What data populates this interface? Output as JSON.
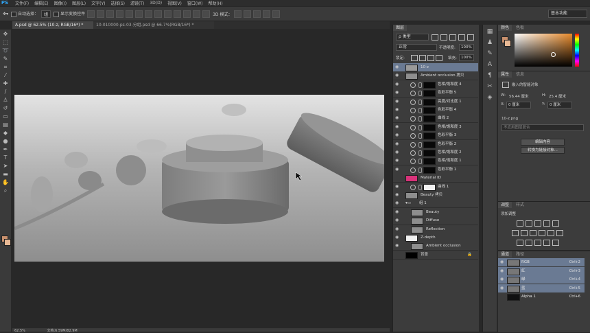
{
  "menubar": {
    "logo": "PS",
    "items": [
      "文件(F)",
      "编辑(E)",
      "图像(I)",
      "图层(L)",
      "文字(Y)",
      "选择(S)",
      "滤镜(T)",
      "3D(D)",
      "视图(V)",
      "窗口(W)",
      "帮助(H)"
    ]
  },
  "options": {
    "auto_select_label": "自动选择：",
    "auto_select_value": "组",
    "show_transform_label": "显示变换控件",
    "mode3d_label": "3D 模式：",
    "workspace": "基本功能"
  },
  "tabs": [
    {
      "label": "A.psd @ 62.5% (10-z, RGB/16*) *"
    },
    {
      "label": "10-010000-ps-03-分组.psd @ 66.7%(RGB/16*) *"
    }
  ],
  "status": {
    "zoom": "62.5%",
    "doc": "文档:6.59M/82.9M"
  },
  "layers_panel": {
    "tabs": [
      "图层"
    ],
    "kind_filter": "ρ 类型",
    "blend_mode": "正常",
    "opacity_label": "不透明度:",
    "opacity_value": "100%",
    "lock_label": "锁定:",
    "fill_label": "填充:",
    "fill_value": "100%",
    "layers": [
      {
        "name": "10-z",
        "type": "smart",
        "selected": true
      },
      {
        "name": "Ambient occlusion 拷贝",
        "type": "pixel"
      },
      {
        "name": "色相/饱和度 4",
        "type": "adj"
      },
      {
        "name": "色彩平衡 5",
        "type": "adj"
      },
      {
        "name": "亮度/对比度 1",
        "type": "adj"
      },
      {
        "name": "色彩平衡 4",
        "type": "adj"
      },
      {
        "name": "曲线 2",
        "type": "adj"
      },
      {
        "name": "色相/饱和度 3",
        "type": "adj"
      },
      {
        "name": "色彩平衡 3",
        "type": "adj"
      },
      {
        "name": "色彩平衡 2",
        "type": "adj"
      },
      {
        "name": "色相/饱和度 2",
        "type": "adj"
      },
      {
        "name": "色相/饱和度 1",
        "type": "adj"
      },
      {
        "name": "色彩平衡 1",
        "type": "adj"
      },
      {
        "name": "Material ID",
        "type": "pixel-pink"
      },
      {
        "name": "曲线 1",
        "type": "adj-white"
      },
      {
        "name": "Beauty 拷贝",
        "type": "pixel"
      },
      {
        "name": "组 1",
        "type": "group"
      },
      {
        "name": "Beauty",
        "type": "pixel-in"
      },
      {
        "name": "Diffuse",
        "type": "pixel-in"
      },
      {
        "name": "Reflection",
        "type": "pixel-in"
      },
      {
        "name": "Z-depth",
        "type": "pixel-white"
      },
      {
        "name": "Ambient occlusion",
        "type": "pixel-in"
      },
      {
        "name": "背景",
        "type": "background"
      }
    ]
  },
  "color_panel": {
    "tabs": [
      "颜色",
      "色板"
    ],
    "fg_color": "#c8906d",
    "bg_color": "#e8b995"
  },
  "properties_panel": {
    "tabs": [
      "属性",
      "信息"
    ],
    "title": "嵌入的智能对象",
    "w_label": "W:",
    "w_value": "56.44 厘米",
    "h_label": "H:",
    "h_value": "25.4 厘米",
    "x_label": "X:",
    "x_value": "0 厘米",
    "y_label": "Y:",
    "y_value": "0 厘米",
    "filename": "10-z.png",
    "comp_placeholder": "不应用图层复合",
    "edit_button": "编辑内容",
    "convert_button": "转换为链接对象..."
  },
  "adjustments_panel": {
    "tabs": [
      "调整",
      "样式"
    ],
    "add_label": "添加调整"
  },
  "channels_panel": {
    "tabs": [
      "通道",
      "路径"
    ],
    "channels": [
      {
        "name": "RGB",
        "key": "Ctrl+2",
        "active": true
      },
      {
        "name": "红",
        "key": "Ctrl+3",
        "active": true
      },
      {
        "name": "绿",
        "key": "Ctrl+4",
        "active": true
      },
      {
        "name": "蓝",
        "key": "Ctrl+5",
        "active": true
      },
      {
        "name": "Alpha 1",
        "key": "Ctrl+6",
        "active": false
      }
    ]
  }
}
